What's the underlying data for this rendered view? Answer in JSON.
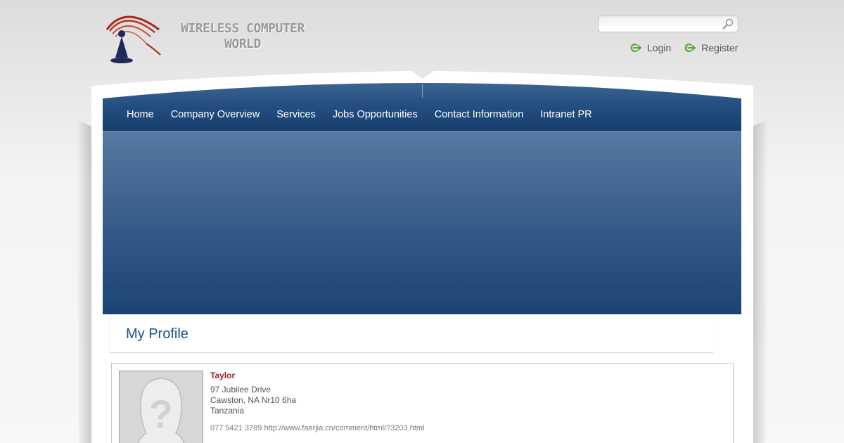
{
  "brand": {
    "logo_text": "WIRELESS COMPUTER\nWORLD"
  },
  "header": {
    "search_placeholder": "",
    "login_label": "Login",
    "register_label": "Register"
  },
  "nav": {
    "items": [
      {
        "label": "Home"
      },
      {
        "label": "Company Overview"
      },
      {
        "label": "Services"
      },
      {
        "label": "Jobs Opportunities"
      },
      {
        "label": "Contact Information"
      },
      {
        "label": "Intranet PR"
      }
    ]
  },
  "profile": {
    "title": "My Profile",
    "name": "Taylor",
    "address": [
      "97 Jubilee Drive",
      "Cawston, NA Nr10 6ha",
      "Tanzania"
    ],
    "phone": "077 5421 3789",
    "url": "http://www.faerjia.cn/comment/html/?3203.html"
  },
  "colors": {
    "nav_blue": "#1f4a7c",
    "banner_top": "#577aa2",
    "banner_bottom": "#1b4474",
    "title_blue": "#1b5186",
    "name_red": "#a11d1d",
    "icon_green": "#5aa63c",
    "logo_red": "#a52a1e",
    "logo_navy": "#1d2a55"
  },
  "icons": {
    "search": "search-icon",
    "login": "login-arrow-icon",
    "register": "register-arrow-icon",
    "avatar": "avatar-placeholder-icon",
    "logo": "antenna-logo-icon"
  }
}
